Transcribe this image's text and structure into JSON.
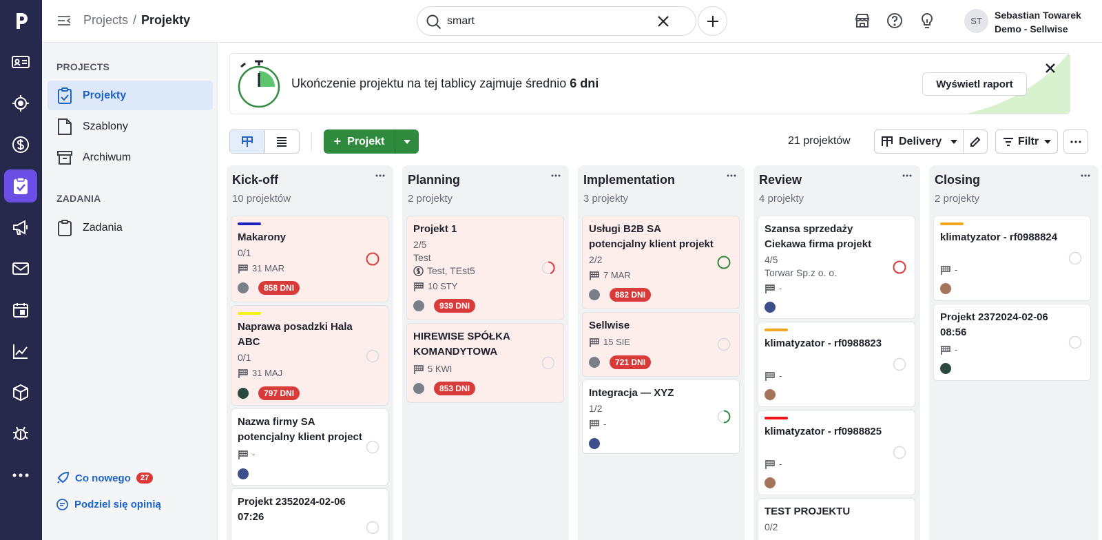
{
  "topbar": {
    "breadcrumb_root": "Projects",
    "breadcrumb_sep": "/",
    "breadcrumb_current": "Projekty",
    "search_value": "smart",
    "user_initials": "ST",
    "user_name": "Sebastian Towarek",
    "user_company": "Demo - Sellwise"
  },
  "sidebar": {
    "projects_title": "PROJECTS",
    "items": [
      {
        "label": "Projekty"
      },
      {
        "label": "Szablony"
      },
      {
        "label": "Archiwum"
      }
    ],
    "tasks_title": "ZADANIA",
    "tasks_item": "Zadania",
    "whats_new": "Co nowego",
    "whats_new_count": "27",
    "feedback": "Podziel się opinią"
  },
  "banner": {
    "text_before": "Ukończenie projektu na tej tablicy zajmuje średnio ",
    "text_bold": "6 dni",
    "button": "Wyświetl raport"
  },
  "toolbar": {
    "add_project": "Projekt",
    "count": "21 projektów",
    "pipeline": "Delivery",
    "filter": "Filtr"
  },
  "columns": [
    {
      "title": "Kick-off",
      "count": "10 projektów",
      "cards": [
        {
          "title": "Makarony",
          "progress": "0/1",
          "date": "31 MAR",
          "overdue": "858 DNI"
        },
        {
          "title": "Naprawa posadzki Hala ABC",
          "progress": "0/1",
          "date": "31 MAJ",
          "overdue": "797 DNI"
        },
        {
          "title": "Nazwa firmy SA potencjalny klient project",
          "date": "-"
        },
        {
          "title": "Projekt 2352024-02-06 07:26"
        }
      ]
    },
    {
      "title": "Planning",
      "count": "2 projekty",
      "cards": [
        {
          "title": "Projekt 1",
          "progress": "2/5",
          "org": "Test",
          "deal": "Test, TEst5",
          "date": "10 STY",
          "overdue": "939 DNI"
        },
        {
          "title": "HIREWISE SPÓŁKA KOMANDYTOWA",
          "date": "5 KWI",
          "overdue": "853 DNI"
        }
      ]
    },
    {
      "title": "Implementation",
      "count": "3 projekty",
      "cards": [
        {
          "title": "Usługi B2B SA potencjalny klient projekt",
          "progress": "2/2",
          "date": "7 MAR",
          "overdue": "882 DNI"
        },
        {
          "title": "Sellwise",
          "date": "15 SIE",
          "overdue": "721 DNI"
        },
        {
          "title": "Integracja — XYZ",
          "progress": "1/2",
          "date": "-"
        }
      ]
    },
    {
      "title": "Review",
      "count": "4 projekty",
      "cards": [
        {
          "title": "Szansa sprzedaży Ciekawa firma projekt",
          "progress": "4/5",
          "org": "Torwar Sp.z o. o.",
          "date": "-"
        },
        {
          "title": "klimatyzator - rf0988823",
          "date": "-"
        },
        {
          "title": "klimatyzator - rf0988825",
          "date": "-"
        },
        {
          "title": "TEST PROJEKTU",
          "progress": "0/2"
        }
      ]
    },
    {
      "title": "Closing",
      "count": "2 projekty",
      "cards": [
        {
          "title": "klimatyzator - rf0988824",
          "date": "-"
        },
        {
          "title": "Projekt 2372024-02-06 08:56",
          "date": "-"
        }
      ]
    }
  ],
  "colors": {
    "rail": "#26294b",
    "rail_active": "#6a4fe6",
    "primary_green": "#2f8a3e",
    "overdue_red": "#d93a3a",
    "link_blue": "#1f63c5",
    "card_overdue_bg": "#fdeeec"
  },
  "icons": [
    "pipedrive-logo-icon",
    "contacts-icon",
    "target-icon",
    "dollar-icon",
    "projects-icon",
    "megaphone-icon",
    "mail-icon",
    "calendar-icon",
    "chart-icon",
    "box-icon",
    "bug-icon",
    "more-icon",
    "search-icon",
    "close-icon",
    "plus-icon",
    "marketplace-icon",
    "help-icon",
    "lightbulb-icon",
    "flag-icon",
    "status-ring-icon"
  ]
}
